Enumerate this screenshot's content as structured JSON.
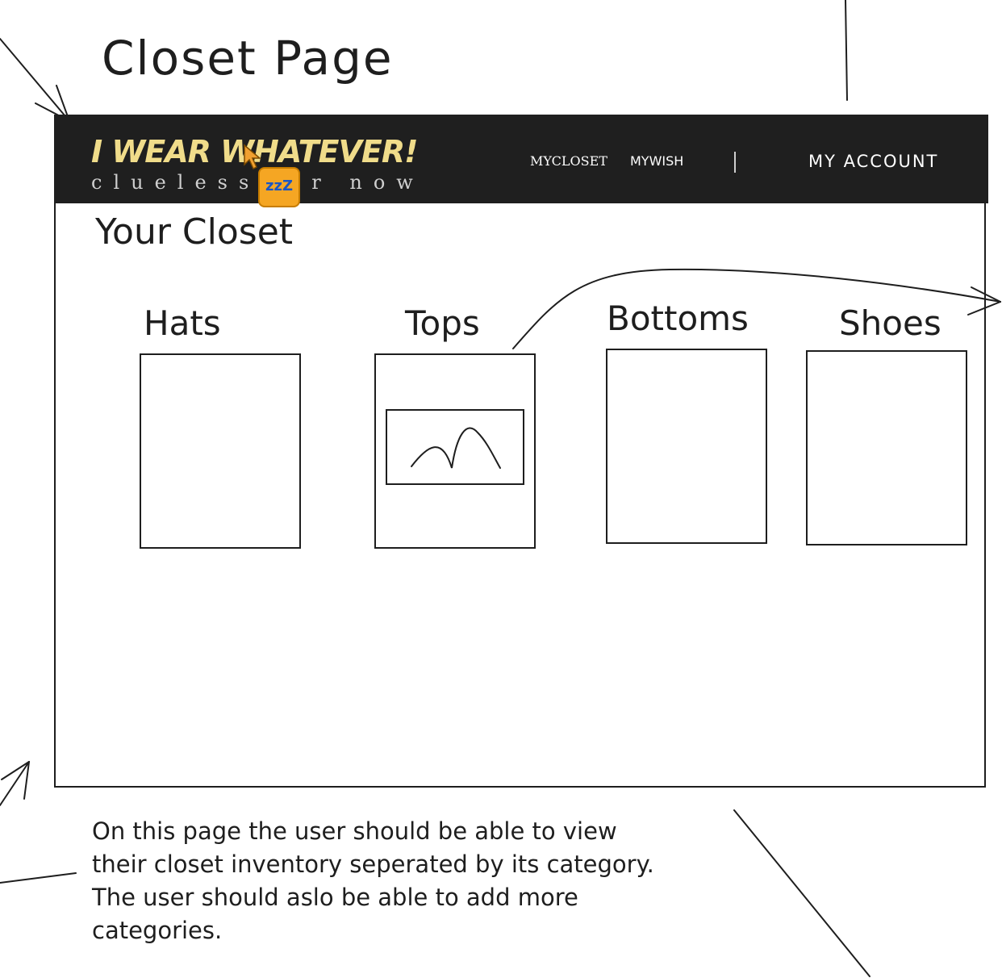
{
  "page_title": "Closet Page",
  "header": {
    "logo_main": "I WEAR WHATEVER!",
    "logo_sub_left": "clueless",
    "logo_sub_right": "r  now",
    "nav": {
      "mycloset": "MYCLOSET",
      "mywish": "MYWISH",
      "account": "MY ACCOUNT"
    },
    "badge_text": "zzZ"
  },
  "main": {
    "section_title": "Your Closet",
    "categories": [
      {
        "label": "Hats"
      },
      {
        "label": "Tops"
      },
      {
        "label": "Bottoms"
      },
      {
        "label": "Shoes"
      }
    ]
  },
  "note": "On this page the user should be able to view their closet inventory seperated by its category. The user should aslo be able to add more categories.",
  "colors": {
    "navbar_bg": "#1f1f1f",
    "logo_accent": "#f0dc8a",
    "badge": "#f5a623",
    "ink": "#1e1e1e"
  }
}
